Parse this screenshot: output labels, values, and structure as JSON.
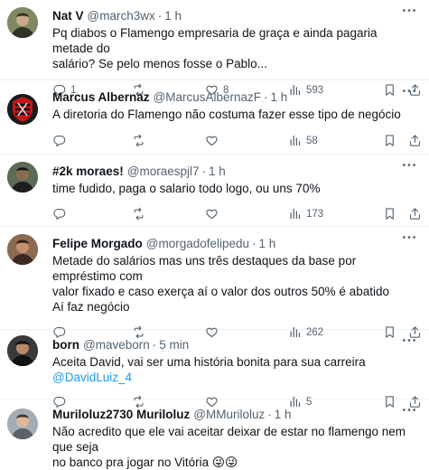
{
  "tweets": [
    {
      "name": "Nat V",
      "handle": "@march3wx",
      "time": "1 h",
      "lines": [
        "Pq diabos o Flamengo empresaria de graça e ainda pagaria metade do",
        "salário? Se pelo menos fosse o Pablo..."
      ],
      "replies": "1",
      "retweets": "",
      "likes": "8",
      "views": "593"
    },
    {
      "name": "Marcus Albernaz",
      "handle": "@MarcusAlbernazF",
      "time": "1 h",
      "lines": [
        "A diretoria do Flamengo não costuma fazer esse tipo de negócio"
      ],
      "replies": "",
      "retweets": "",
      "likes": "",
      "views": "58"
    },
    {
      "name": "#2k moraes!",
      "handle": "@moraespjl7",
      "time": "1 h",
      "lines": [
        "time fudido, paga o salario todo logo, ou uns 70%"
      ],
      "replies": "",
      "retweets": "",
      "likes": "",
      "views": "173"
    },
    {
      "name": "Felipe Morgado",
      "handle": "@morgadofelipedu",
      "time": "1 h",
      "lines": [
        "Metade do salários mas uns três destaques da base por empréstimo com",
        "valor fixado e caso exerça aí o valor dos outros 50% é abatido",
        "Aí faz negócio"
      ],
      "replies": "",
      "retweets": "",
      "likes": "",
      "views": "262"
    },
    {
      "name": "born",
      "handle": "@maveborn",
      "time": "5 min",
      "text": "Aceita David, vai ser uma história bonita para sua carreira ",
      "mention": "@DavidLuiz_4",
      "replies": "",
      "retweets": "",
      "likes": "",
      "views": "5"
    },
    {
      "name": "Muriloluz2730 Muriloluz",
      "handle": "@MMuriloluz",
      "time": "1 h",
      "lines": [
        "Não acredito que ele vai aceitar deixar de estar no flamengo nem que seja",
        "no banco pra jogar no Vitória"
      ],
      "emoji": "😜😜"
    }
  ]
}
